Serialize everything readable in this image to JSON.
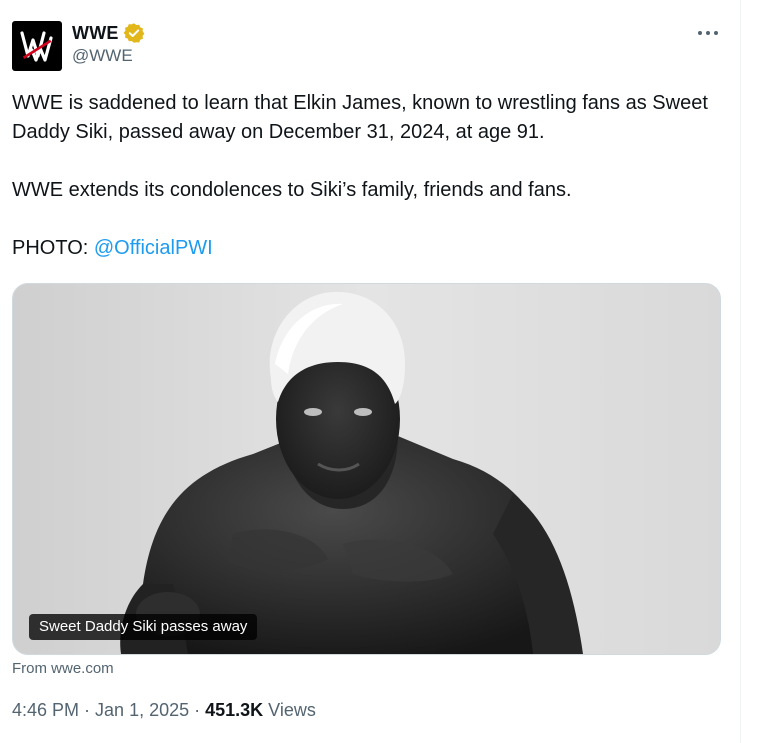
{
  "author": {
    "display_name": "WWE",
    "handle": "@WWE",
    "verified": true,
    "avatar_icon": "wwe-logo-icon"
  },
  "tweet": {
    "paragraph1": "WWE is saddened to learn that Elkin James, known to wrestling fans as Sweet Daddy Siki, passed away on December 31, 2024, at age 91.",
    "paragraph2": "WWE extends its condolences to Siki’s family, friends and fans.",
    "photo_prefix": "PHOTO: ",
    "photo_mention": "@OfficialPWI"
  },
  "media": {
    "caption": "Sweet Daddy Siki passes away",
    "source": "From wwe.com"
  },
  "meta": {
    "time": "4:46 PM",
    "separator": "·",
    "date": "Jan 1, 2025",
    "views_count": "451.3K",
    "views_label": "Views"
  },
  "colors": {
    "link": "#1d9bf0",
    "verified_badge": "#e2b719",
    "secondary_text": "#536471"
  },
  "icons": [
    "wwe-logo-icon",
    "verified-badge-icon",
    "more-options-icon"
  ]
}
